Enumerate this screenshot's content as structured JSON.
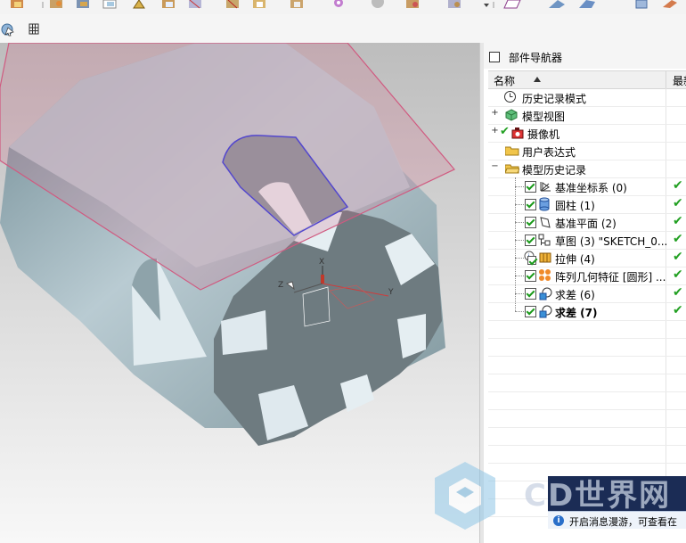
{
  "toolbar": {
    "icons": [
      "feature-icon",
      "rotate-icon",
      "render-icon",
      "shade-icon",
      "measure-icon",
      "edit-icon",
      "delete-icon",
      "copy-icon",
      "move-icon",
      "assembly-icon",
      "gear-icon",
      "view-icon",
      "pin-icon",
      "layer-icon",
      "display-icon"
    ],
    "secondary_icons": [
      "select-icon",
      "grid-icon"
    ]
  },
  "navigator": {
    "title": "部件导航器",
    "col_name": "名称",
    "col_latest": "最新",
    "rows": [
      {
        "label": "历史记录模式",
        "icon": "clock-icon"
      },
      {
        "label": "模型视图",
        "icon": "model-view-icon"
      },
      {
        "label": "摄像机",
        "icon": "camera-icon"
      },
      {
        "label": "用户表达式",
        "icon": "folder-icon"
      },
      {
        "label": "模型历史记录",
        "icon": "folder-icon"
      },
      {
        "label": "基准坐标系 (0)",
        "icon": "datum-csys-icon"
      },
      {
        "label": "圆柱 (1)",
        "icon": "cylinder-icon"
      },
      {
        "label": "基准平面 (2)",
        "icon": "datum-plane-icon"
      },
      {
        "label": "草图 (3) \"SKETCH_0...",
        "icon": "sketch-icon"
      },
      {
        "label": "拉伸 (4)",
        "icon": "extrude-icon"
      },
      {
        "label": "阵列几何特征 [圆形] ...",
        "icon": "pattern-icon"
      },
      {
        "label": "求差 (6)",
        "icon": "subtract-icon"
      },
      {
        "label": "求差 (7)",
        "icon": "subtract-icon"
      }
    ]
  },
  "notification": {
    "text": "开启消息漫游，可查看在"
  },
  "watermark": {
    "text": "CD世界网"
  },
  "colors": {
    "accent": "#22a022",
    "datum_plane": "#d56b8a",
    "body": "#aab9c1",
    "banner": "#1b2c55"
  }
}
